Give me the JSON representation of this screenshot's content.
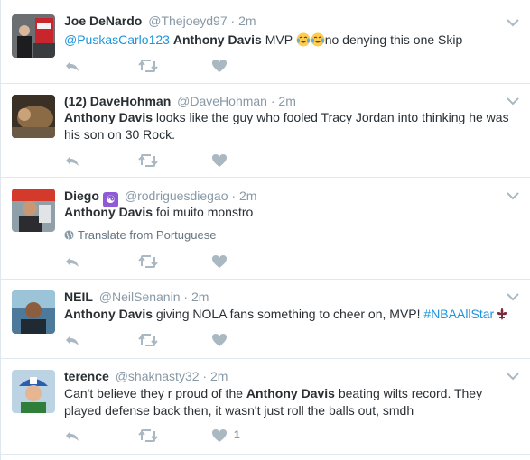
{
  "tweets": [
    {
      "name": "Joe DeNardo",
      "handle": "@Thejoeyd97",
      "dot": "·",
      "time": "2m",
      "mention": "@PuskasCarlo123",
      "highlight": "Anthony Davis",
      "rest": "MVP",
      "after_emoji": "no denying this one Skip",
      "emoji_icon": "tears-of-joy-emoji"
    },
    {
      "name": "(12) DaveHohman",
      "handle": "@DaveHohman",
      "dot": "·",
      "time": "2m",
      "highlight": "Anthony Davis",
      "rest": "looks like the guy who fooled Tracy Jordan into thinking he was his son on 30 Rock."
    },
    {
      "name": "Diego",
      "badge": "☯",
      "handle": "@rodriguesdiegao",
      "dot": "·",
      "time": "2m",
      "highlight": "Anthony Davis",
      "rest": "foi muito monstro",
      "translate": "Translate from Portuguese"
    },
    {
      "name": "NEIL",
      "handle": "@NeilSenanin",
      "dot": "·",
      "time": "2m",
      "highlight": "Anthony Davis",
      "rest": "giving NOLA fans something to cheer on, MVP!",
      "hashtag": "#NBAAllStar"
    },
    {
      "name": "terence",
      "handle": "@shaknasty32",
      "dot": "·",
      "time": "2m",
      "before": "Can't believe they r proud of the",
      "highlight": "Anthony Davis",
      "rest": "beating wilts record. They played defense back then, it wasn't just roll the balls out, smdh",
      "like_count": "1"
    }
  ],
  "colors": {
    "link": "#1b95e0",
    "muted": "#8899a6",
    "text": "#292f33",
    "divider": "#e1e8ed",
    "icon": "#aab8c2"
  },
  "icons": [
    "reply-icon",
    "retweet-icon",
    "heart-icon",
    "chevron-down-icon",
    "globe-icon",
    "fleur-de-lis-icon"
  ]
}
